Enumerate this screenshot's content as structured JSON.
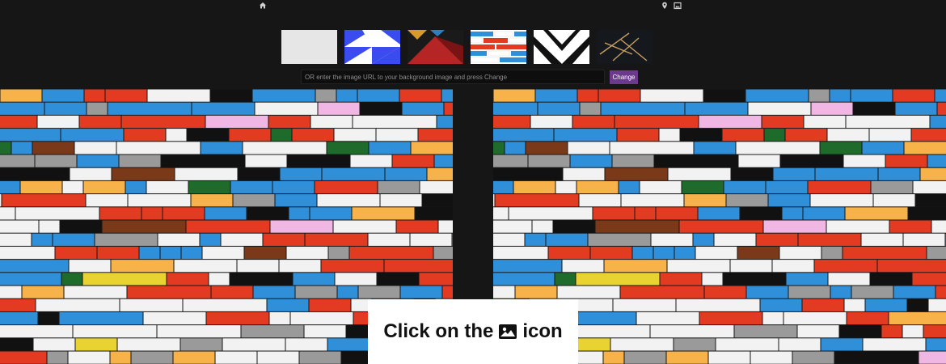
{
  "toolbar": {
    "icons": [
      "home-icon",
      "location-pin-icon",
      "image-icon"
    ],
    "thumbnails": [
      {
        "name": "plain-grey",
        "colors": [
          "#e6e6e6"
        ]
      },
      {
        "name": "blue-triangles",
        "colors": [
          "#3a4bf0",
          "#ffffff"
        ]
      },
      {
        "name": "red-dark-geometric",
        "colors": [
          "#1a1a1a",
          "#b62525",
          "#d89a2a",
          "#2d7fbf"
        ]
      },
      {
        "name": "lego-bricks",
        "colors": [
          "#ffffff",
          "#e23b22",
          "#2f8fd8"
        ]
      },
      {
        "name": "black-white-chevron",
        "colors": [
          "#ffffff",
          "#111111"
        ]
      },
      {
        "name": "branches-dark",
        "colors": [
          "#15181d",
          "#c9a063"
        ]
      }
    ]
  },
  "url_form": {
    "placeholder": "OR enter the image URL to your background image and press Change",
    "button_label": "Change"
  },
  "background": {
    "name": "lego-bricks-wall",
    "colors": [
      "#f2f2f2",
      "#e23b22",
      "#2f8fd8",
      "#f7b24a",
      "#111111",
      "#9a9a9a",
      "#e9d331",
      "#f1b7e4"
    ]
  },
  "overlay": {
    "before": "Click on the",
    "icon": "image-icon",
    "after": "icon"
  },
  "colors": {
    "topbar_bg": "#161616",
    "button_bg": "#6b3a8c"
  }
}
